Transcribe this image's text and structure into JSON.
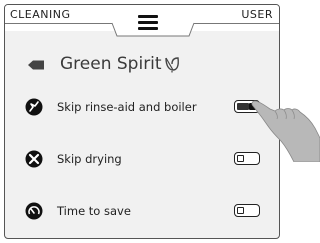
{
  "header": {
    "left_tab": "CLEANING",
    "right_tab": "USER",
    "menu_icon": "hamburger-menu-icon"
  },
  "title": {
    "text": "Green Spirit",
    "back_icon": "back-arrow-icon",
    "leaf_icon": "leaf-icon"
  },
  "options": [
    {
      "label": "Skip rinse-aid and boiler",
      "icon": "rinse-boiler-icon",
      "enabled": true
    },
    {
      "label": "Skip drying",
      "icon": "drying-icon",
      "enabled": false
    },
    {
      "label": "Time to save",
      "icon": "gauge-icon",
      "enabled": false
    }
  ],
  "colors": {
    "panel_bg": "#f1f1f1",
    "ink": "#222222",
    "hand": "#b8b8b8"
  },
  "pointer": "pointing-hand-icon"
}
